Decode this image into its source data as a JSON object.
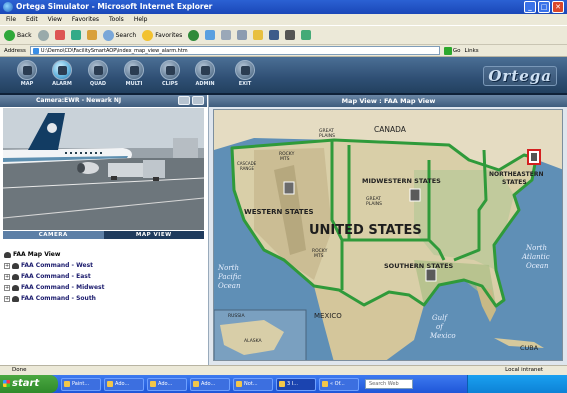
{
  "window": {
    "title": "Ortega Simulator - Microsoft Internet Explorer"
  },
  "menu": [
    "File",
    "Edit",
    "View",
    "Favorites",
    "Tools",
    "Help"
  ],
  "toolbar": {
    "back": "Back",
    "search": "Search",
    "favorites": "Favorites"
  },
  "address": {
    "label": "Address",
    "url": "U:\\Demo\\CD\\FacilitySmartAOP\\index_map_view_alarm.htm",
    "go": "Go",
    "links": "Links"
  },
  "app": {
    "logo": "Ortega",
    "nav": [
      {
        "label": "MAP",
        "name": "nav-map"
      },
      {
        "label": "ALARM",
        "name": "nav-alarm"
      },
      {
        "label": "QUAD",
        "name": "nav-quad"
      },
      {
        "label": "MULTI",
        "name": "nav-multi"
      },
      {
        "label": "CLIPS",
        "name": "nav-clips"
      },
      {
        "label": "ADMIN",
        "name": "nav-admin"
      },
      {
        "label": "EXIT",
        "name": "nav-exit"
      }
    ]
  },
  "camera": {
    "header": "Camera:EWR - Newark NJ",
    "tabs": [
      "CAMERA",
      "MAP VIEW"
    ]
  },
  "tree": {
    "root": "FAA Map View",
    "items": [
      "FAA Command - West",
      "FAA Command - East",
      "FAA Command - Midwest",
      "FAA Command - South"
    ]
  },
  "map": {
    "header": "Map View : FAA Map View",
    "labels": {
      "canada": "CANADA",
      "great_plains": "GREAT\nPLAINS",
      "rocky": "ROCKY\nMTS",
      "cascade": "CASCADE\nRANGE",
      "western": "WESTERN STATES",
      "midwestern": "MIDWESTERN STATES",
      "northeastern": "NORTHEASTERN\nSTATES",
      "southern": "SOUTHERN STATES",
      "united_states": "UNITED STATES",
      "pacific": "North\nPacific\nOcean",
      "atlantic": "North\nAtlantic\nOcean",
      "mexico": "MEXICO",
      "gulf": "Gulf\nof\nMexico",
      "cuba": "CUBA",
      "russia": "RUSSIA",
      "alaska": "ALASKA"
    },
    "colors": {
      "region_border": "#2f9a3a",
      "alarm": "#d42020"
    }
  },
  "status": {
    "left": "Done",
    "zone": "Local intranet"
  },
  "taskbar": {
    "start": "start",
    "tasks": [
      "Paint...",
      "Ado...",
      "Ado...",
      "Ado...",
      "Not...",
      "3 I...",
      "« Of..."
    ],
    "search": "Search Web"
  }
}
